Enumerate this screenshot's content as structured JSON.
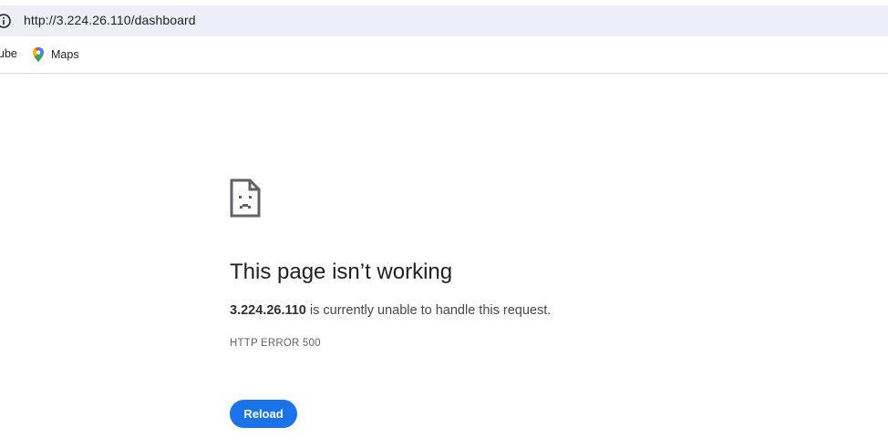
{
  "browser": {
    "url": "http://3.224.26.110/dashboard",
    "bookmarks": [
      {
        "label": "ube",
        "icon": "youtube-icon"
      },
      {
        "label": "Maps",
        "icon": "maps-icon"
      }
    ]
  },
  "error_page": {
    "icon": "sad-page-icon",
    "title": "This page isn’t working",
    "host": "3.224.26.110",
    "message": " is currently unable to handle this request.",
    "error_code": "HTTP ERROR 500",
    "reload_label": "Reload"
  },
  "colors": {
    "omnibox_bg": "#eceff7",
    "button_blue": "#1a73e8",
    "title_text": "#202124"
  }
}
